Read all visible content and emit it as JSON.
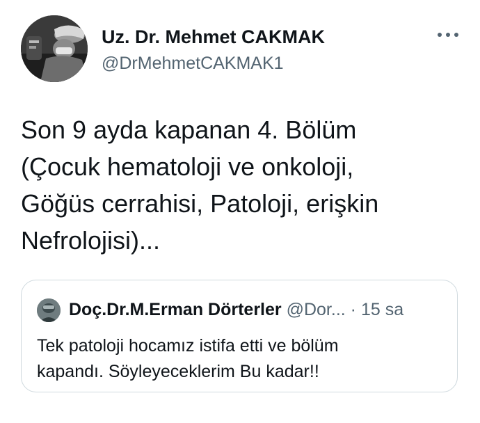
{
  "tweet": {
    "author_name": "Uz. Dr. Mehmet CAKMAK",
    "author_handle": "@DrMehmetCAKMAK1",
    "more_icon": "more-horizontal-icon",
    "text": "Son 9 ayda kapanan 4. Bölüm\n(Çocuk hematoloji ve onkoloji,\nGöğüs cerrahisi, Patoloji, erişkin\nNefrolojisi)..."
  },
  "quoted_tweet": {
    "author_name": "Doç.Dr.M.Erman Dörterler",
    "author_handle": "@Dor...",
    "separator": "·",
    "time": "15 sa",
    "text": "Tek patoloji hocamız istifa etti ve bölüm\nkapandı. Söyleyeceklerim Bu kadar!!"
  },
  "colors": {
    "primary_text": "#0f1419",
    "secondary_text": "#536471",
    "border": "#cfd9de",
    "background": "#ffffff"
  }
}
